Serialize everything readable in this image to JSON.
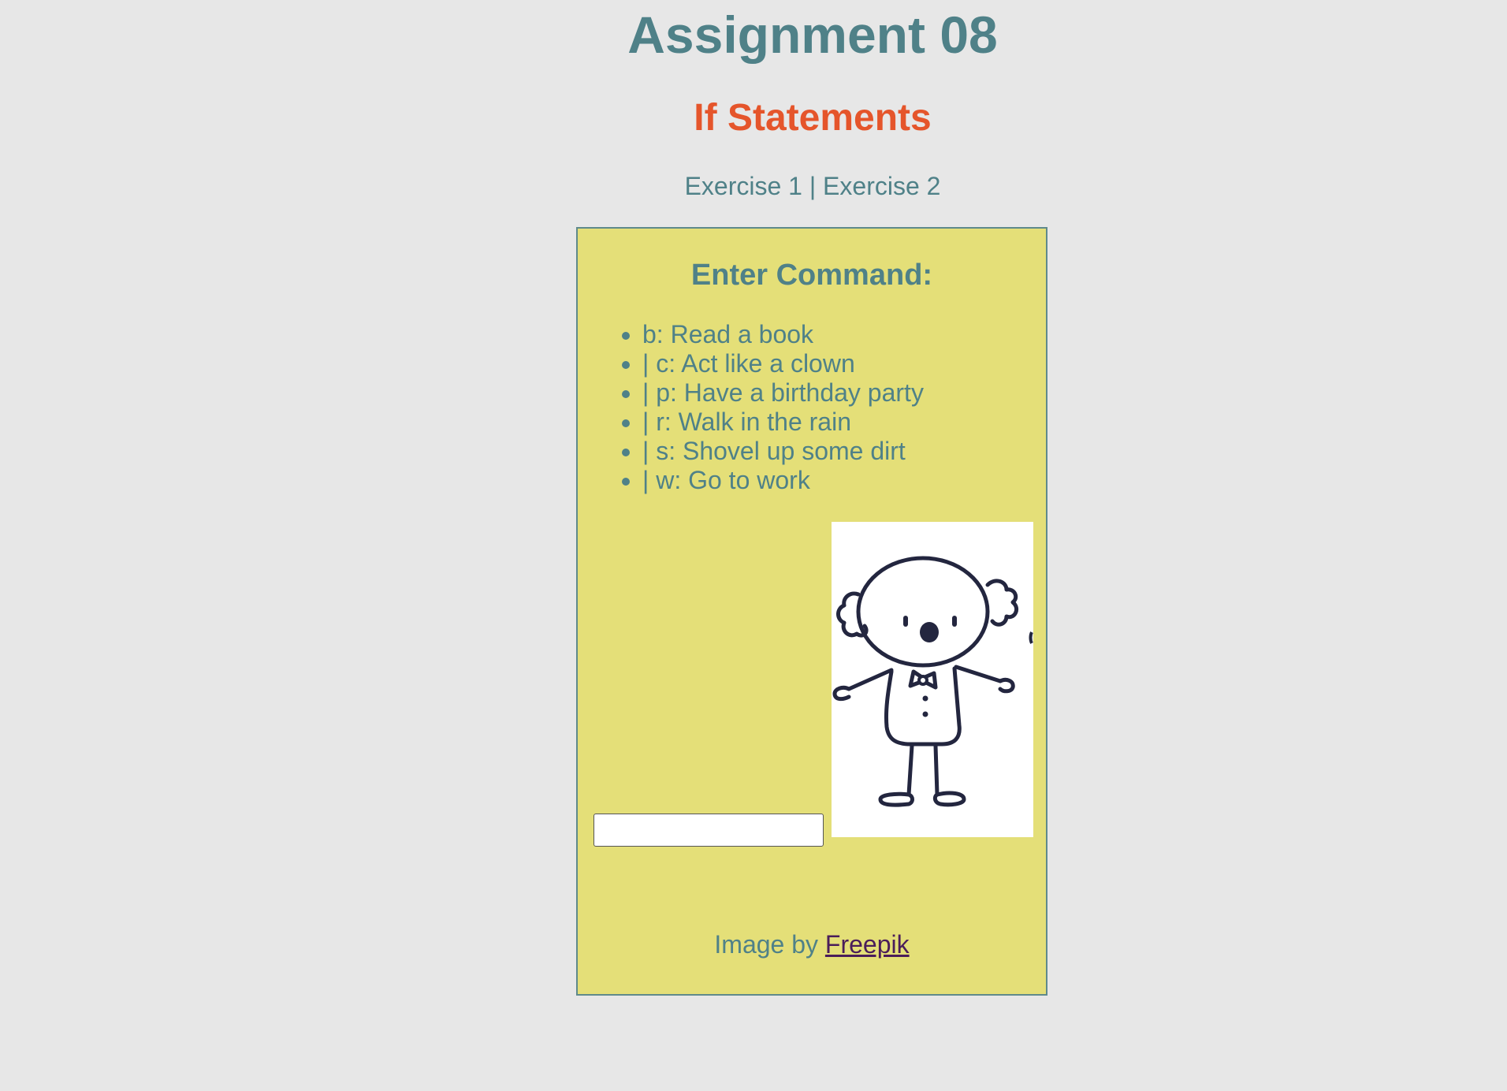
{
  "header": {
    "title": "Assignment 08",
    "subtitle": "If Statements"
  },
  "nav": {
    "links": [
      {
        "label": "Exercise 1"
      },
      {
        "label": "Exercise 2"
      }
    ],
    "separator": " | "
  },
  "panel": {
    "heading": "Enter Command:",
    "commands": [
      "b: Read a book",
      "| c: Act like a clown",
      "| p: Have a birthday party",
      "| r: Walk in the rain",
      "| s: Shovel up some dirt",
      "| w: Go to work"
    ],
    "input": {
      "value": "",
      "placeholder": ""
    },
    "image": {
      "icon": "clown-illustration"
    },
    "attribution": {
      "prefix": "Image by ",
      "link_label": "Freepik"
    }
  },
  "colors": {
    "background": "#e7e7e7",
    "primary_text": "#4f8188",
    "subtitle": "#e5552b",
    "panel_bg": "#e4df78",
    "panel_border": "#5f8a8c",
    "link_visited": "#4a1d5a",
    "illustration_stroke": "#23263f"
  }
}
